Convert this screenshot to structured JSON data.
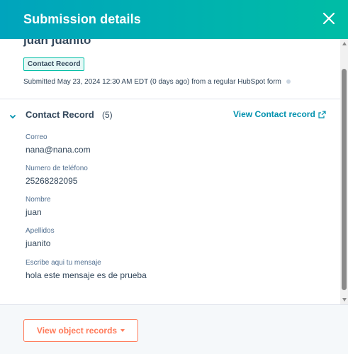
{
  "header": {
    "title": "Submission details",
    "close_icon": "close-icon"
  },
  "submission": {
    "name": "juan juanito",
    "record_tag": "Contact Record",
    "submitted_text": "Submitted May 23, 2024 12:30 AM EDT (0 days ago) from a regular HubSpot form"
  },
  "section": {
    "title": "Contact Record",
    "count": "(5)",
    "view_link": "View Contact record",
    "link_icon": "external-link-icon"
  },
  "fields": [
    {
      "label": "Correo",
      "value": "nana@nana.com"
    },
    {
      "label": "Numero de teléfono",
      "value": "25268282095"
    },
    {
      "label": "Nombre",
      "value": "juan"
    },
    {
      "label": "Apellidos",
      "value": "juanito"
    },
    {
      "label": "Escribe aqui tu mensaje",
      "value": "hola este mensaje es de prueba"
    }
  ],
  "footer": {
    "button_label": "View object records"
  },
  "colors": {
    "header_start": "#00a4bd",
    "header_end": "#00bda5",
    "link": "#0091ae",
    "primary_button": "#ff7a59",
    "text": "#33475b"
  }
}
